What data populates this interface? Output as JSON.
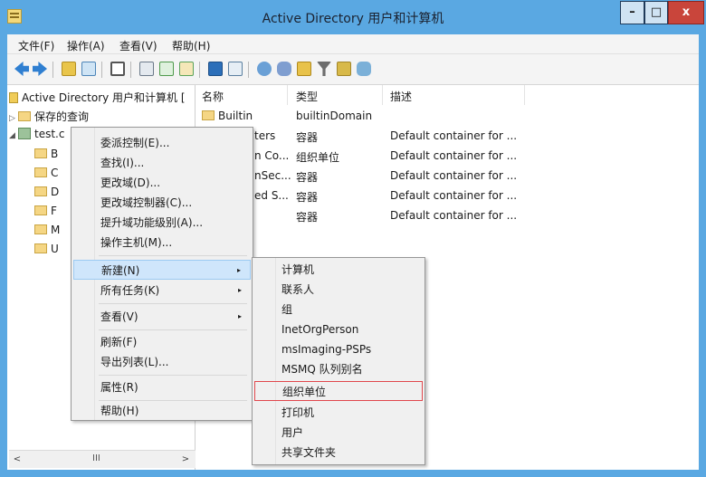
{
  "window": {
    "title": "Active Directory 用户和计算机",
    "btn_min": "–",
    "btn_max": "□",
    "btn_close": "x"
  },
  "menubar": [
    "文件(F)",
    "操作(A)",
    "查看(V)",
    "帮助(H)"
  ],
  "toolbar_icons": [
    "back-icon",
    "forward-icon",
    "up-folder-icon",
    "show-hide-tree-icon",
    "properties-icon",
    "copy-icon",
    "refresh-icon",
    "export-list-icon",
    "help-icon",
    "console-icon",
    "user-icon",
    "group-icon",
    "ou-icon",
    "filter-icon",
    "find-icon",
    "delegate-icon"
  ],
  "tree": {
    "root": "Active Directory 用户和计算机 [",
    "saved_queries": "保存的查询",
    "domain": "test.c",
    "children": [
      "B",
      "C",
      "D",
      "F",
      "M",
      "U"
    ]
  },
  "scroll": {
    "grip": "III"
  },
  "list": {
    "columns": [
      "名称",
      "类型",
      "描述"
    ],
    "rows": [
      {
        "name": "Builtin",
        "type": "builtinDomain",
        "desc": ""
      },
      {
        "name": "ters",
        "type": "容器",
        "desc": "Default container for ..."
      },
      {
        "name": "n Co...",
        "type": "组织单位",
        "desc": "Default container for ..."
      },
      {
        "name": "nSec...",
        "type": "容器",
        "desc": "Default container for ..."
      },
      {
        "name": "ed S...",
        "type": "容器",
        "desc": "Default container for ..."
      },
      {
        "name": "",
        "type": "容器",
        "desc": "Default container for ..."
      }
    ]
  },
  "context_menu": {
    "items": [
      "委派控制(E)...",
      "查找(I)...",
      "更改域(D)...",
      "更改域控制器(C)...",
      "提升域功能级别(A)...",
      "操作主机(M)...",
      "新建(N)",
      "所有任务(K)",
      "查看(V)",
      "刷新(F)",
      "导出列表(L)...",
      "属性(R)",
      "帮助(H)"
    ],
    "submenu_arrow": "▸"
  },
  "new_submenu": {
    "items": [
      "计算机",
      "联系人",
      "组",
      "InetOrgPerson",
      "msImaging-PSPs",
      "MSMQ 队列别名",
      "组织单位",
      "打印机",
      "用户",
      "共享文件夹"
    ]
  }
}
